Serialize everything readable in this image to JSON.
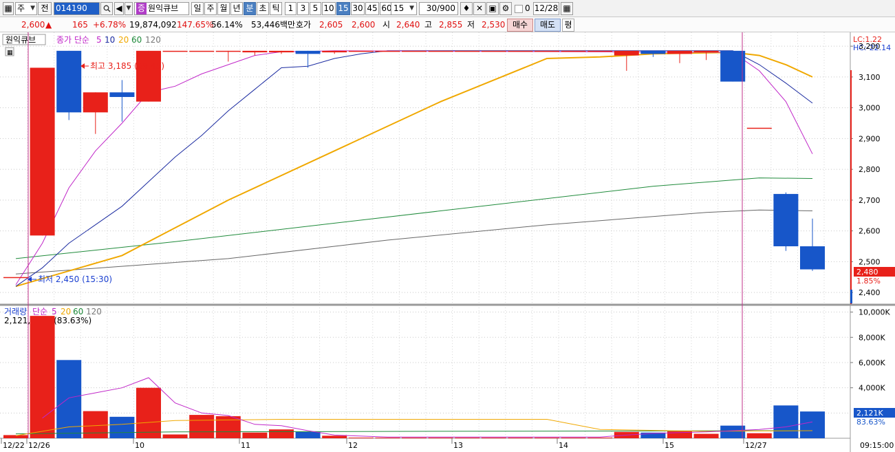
{
  "toolbar": {
    "type_label": "주",
    "prev_label": "전",
    "code": "014190",
    "badge": "증",
    "stock_name": "원익큐브",
    "period_buttons": [
      "일",
      "주",
      "월",
      "년",
      "분",
      "초",
      "틱"
    ],
    "selected_period": "분",
    "interval_buttons": [
      "1",
      "3",
      "5",
      "10",
      "15",
      "30",
      "45",
      "60"
    ],
    "selected_interval": "15",
    "interval_value": "15",
    "count_value": "30/900",
    "checkbox_label": "0",
    "date_value": "12/28"
  },
  "info": {
    "price": "2,600",
    "change": "165",
    "change_pct": "+6.78%",
    "volume": "19,874,092",
    "volume_ratio": "147.65%",
    "turnover_ratio": "56.14%",
    "amount": "53,446백만",
    "quote_label": "호가",
    "ask": "2,605",
    "bid": "2,600",
    "open_label": "시",
    "open": "2,640",
    "high_label": "고",
    "high": "2,855",
    "low_label": "저",
    "low": "2,530",
    "buy_label": "매수",
    "sell_label": "매도",
    "pyeong_label": "평"
  },
  "colors": {
    "up": "#e8211a",
    "down": "#1756c9",
    "ma5": "#c026c8",
    "ma10": "#1a2aa0",
    "ma20": "#f0a800",
    "ma60": "#1e8a3a",
    "ma120": "#666666"
  },
  "price_panel": {
    "title": "원익큐브",
    "legend": {
      "label": "종가 단순",
      "ma5": "5",
      "ma10": "10",
      "ma20": "20",
      "ma60": "60",
      "ma120": "120"
    },
    "lc": "LC:1.22",
    "hc": "HC:-22.14",
    "high_note": "최고 3,185 (09:45)",
    "low_note": "최저 2,450 (15:30)",
    "current_price": "2,480",
    "current_pct": "1.85%"
  },
  "volume_panel": {
    "legend": {
      "label": "거래량",
      "type": "단순",
      "ma5": "5",
      "ma20": "20",
      "ma60": "60",
      "ma120": "120"
    },
    "summary": "2,121,435주(83.63%)",
    "current_volume": "2,121K",
    "current_pct": "83.63%"
  },
  "time_axis": {
    "labels": [
      "12/22",
      "12/26",
      "10",
      "11",
      "12",
      "13",
      "14",
      "15",
      "12/27"
    ],
    "clock": "09:15:00"
  },
  "chart_data": {
    "type": "candlestick",
    "price_axis": {
      "ticks": [
        "3,200",
        "3,100",
        "3,000",
        "2,900",
        "2,800",
        "2,700",
        "2,600",
        "2,500",
        "2,400"
      ],
      "range": [
        2360,
        3245
      ]
    },
    "volume_axis": {
      "ticks": [
        "10,000K",
        "8,000K",
        "6,000K",
        "4,000K"
      ],
      "range": [
        0,
        10000
      ]
    },
    "candles": [
      {
        "o": 2450,
        "h": 2450,
        "l": 2450,
        "c": 2450,
        "v": 250
      },
      {
        "o": 2585,
        "h": 3130,
        "l": 2585,
        "c": 3130,
        "v": 9700
      },
      {
        "o": 3185,
        "h": 3185,
        "l": 2960,
        "c": 2985,
        "v": 6200
      },
      {
        "o": 2985,
        "h": 3050,
        "l": 2915,
        "c": 3050,
        "v": 2150
      },
      {
        "o": 3050,
        "h": 3090,
        "l": 2955,
        "c": 3035,
        "v": 1700
      },
      {
        "o": 3020,
        "h": 3185,
        "l": 3020,
        "c": 3185,
        "v": 4000
      },
      {
        "o": 3185,
        "h": 3185,
        "l": 3185,
        "c": 3185,
        "v": 300
      },
      {
        "o": 3185,
        "h": 3185,
        "l": 3185,
        "c": 3185,
        "v": 1850
      },
      {
        "o": 3185,
        "h": 3185,
        "l": 3150,
        "c": 3185,
        "v": 1750
      },
      {
        "o": 3180,
        "h": 3185,
        "l": 3170,
        "c": 3185,
        "v": 450
      },
      {
        "o": 3180,
        "h": 3185,
        "l": 3175,
        "c": 3185,
        "v": 700
      },
      {
        "o": 3185,
        "h": 3185,
        "l": 3130,
        "c": 3175,
        "v": 500
      },
      {
        "o": 3180,
        "h": 3185,
        "l": 3175,
        "c": 3185,
        "v": 200
      },
      {
        "o": 3185,
        "h": 3185,
        "l": 3185,
        "c": 3185,
        "v": 50
      },
      {
        "o": 3185,
        "h": 3185,
        "l": 3185,
        "c": 3185,
        "v": 50
      },
      {
        "o": 3185,
        "h": 3185,
        "l": 3185,
        "c": 3185,
        "v": 50
      },
      {
        "o": 3185,
        "h": 3185,
        "l": 3185,
        "c": 3185,
        "v": 50
      },
      {
        "o": 3185,
        "h": 3185,
        "l": 3185,
        "c": 3185,
        "v": 50
      },
      {
        "o": 3185,
        "h": 3185,
        "l": 3185,
        "c": 3185,
        "v": 50
      },
      {
        "o": 3185,
        "h": 3185,
        "l": 3185,
        "c": 3185,
        "v": 50
      },
      {
        "o": 3185,
        "h": 3185,
        "l": 3185,
        "c": 3185,
        "v": 50
      },
      {
        "o": 3185,
        "h": 3185,
        "l": 3185,
        "c": 3185,
        "v": 50
      },
      {
        "o": 3185,
        "h": 3185,
        "l": 3185,
        "c": 3185,
        "v": 50
      },
      {
        "o": 3170,
        "h": 3185,
        "l": 3120,
        "c": 3185,
        "v": 500
      },
      {
        "o": 3185,
        "h": 3185,
        "l": 3165,
        "c": 3175,
        "v": 450
      },
      {
        "o": 3175,
        "h": 3185,
        "l": 3145,
        "c": 3185,
        "v": 550
      },
      {
        "o": 3180,
        "h": 3185,
        "l": 3155,
        "c": 3185,
        "v": 350
      },
      {
        "o": 3185,
        "h": 3185,
        "l": 3085,
        "c": 3085,
        "v": 1000
      },
      {
        "o": 2935,
        "h": 2935,
        "l": 2935,
        "c": 2935,
        "v": 400
      },
      {
        "o": 2720,
        "h": 2725,
        "l": 2535,
        "c": 2550,
        "v": 2600
      },
      {
        "o": 2550,
        "h": 2640,
        "l": 2470,
        "c": 2475,
        "v": 2121
      }
    ],
    "ma5": [
      [
        0,
        2425
      ],
      [
        1,
        2560
      ],
      [
        2,
        2740
      ],
      [
        3,
        2860
      ],
      [
        4,
        2950
      ],
      [
        5,
        3050
      ],
      [
        6,
        3070
      ],
      [
        7,
        3110
      ],
      [
        8,
        3140
      ],
      [
        9,
        3170
      ],
      [
        10,
        3182
      ],
      [
        11,
        3183
      ],
      [
        12,
        3185
      ],
      [
        27,
        3180
      ],
      [
        28,
        3120
      ],
      [
        29,
        3020
      ],
      [
        30,
        2850
      ]
    ],
    "ma10": [
      [
        0,
        2420
      ],
      [
        1,
        2480
      ],
      [
        2,
        2560
      ],
      [
        3,
        2620
      ],
      [
        4,
        2680
      ],
      [
        5,
        2760
      ],
      [
        6,
        2840
      ],
      [
        7,
        2910
      ],
      [
        8,
        2990
      ],
      [
        9,
        3060
      ],
      [
        10,
        3130
      ],
      [
        11,
        3135
      ],
      [
        12,
        3160
      ],
      [
        13,
        3175
      ],
      [
        14,
        3185
      ],
      [
        27,
        3185
      ],
      [
        28,
        3140
      ],
      [
        29,
        3080
      ],
      [
        30,
        3015
      ]
    ],
    "ma20": [
      [
        0,
        2420
      ],
      [
        4,
        2520
      ],
      [
        6,
        2610
      ],
      [
        8,
        2700
      ],
      [
        12,
        2860
      ],
      [
        16,
        3020
      ],
      [
        20,
        3160
      ],
      [
        22,
        3165
      ],
      [
        24,
        3175
      ],
      [
        27,
        3180
      ],
      [
        28,
        3170
      ],
      [
        29,
        3140
      ],
      [
        30,
        3100
      ]
    ],
    "ma60": [
      [
        0,
        2510
      ],
      [
        6,
        2565
      ],
      [
        12,
        2625
      ],
      [
        18,
        2685
      ],
      [
        24,
        2745
      ],
      [
        28,
        2772
      ],
      [
        30,
        2770
      ]
    ],
    "ma120": [
      [
        0,
        2460
      ],
      [
        8,
        2510
      ],
      [
        14,
        2570
      ],
      [
        20,
        2620
      ],
      [
        26,
        2660
      ],
      [
        28,
        2668
      ],
      [
        30,
        2665
      ]
    ],
    "vma5": [
      [
        1,
        1600
      ],
      [
        2,
        3200
      ],
      [
        3,
        3600
      ],
      [
        4,
        4000
      ],
      [
        5,
        4800
      ],
      [
        6,
        2800
      ],
      [
        7,
        2000
      ],
      [
        8,
        1800
      ],
      [
        9,
        1100
      ],
      [
        10,
        1000
      ],
      [
        11,
        600
      ],
      [
        12,
        250
      ],
      [
        14,
        100
      ],
      [
        22,
        100
      ],
      [
        23,
        250
      ],
      [
        24,
        380
      ],
      [
        25,
        450
      ],
      [
        26,
        500
      ],
      [
        27,
        600
      ],
      [
        28,
        700
      ],
      [
        29,
        900
      ],
      [
        30,
        1300
      ]
    ],
    "vma20": [
      [
        0,
        200
      ],
      [
        2,
        900
      ],
      [
        4,
        1100
      ],
      [
        6,
        1400
      ],
      [
        10,
        1500
      ],
      [
        20,
        1500
      ],
      [
        22,
        700
      ],
      [
        26,
        550
      ],
      [
        30,
        600
      ]
    ],
    "vma60": [
      [
        0,
        350
      ],
      [
        6,
        500
      ],
      [
        16,
        550
      ],
      [
        30,
        600
      ]
    ]
  }
}
